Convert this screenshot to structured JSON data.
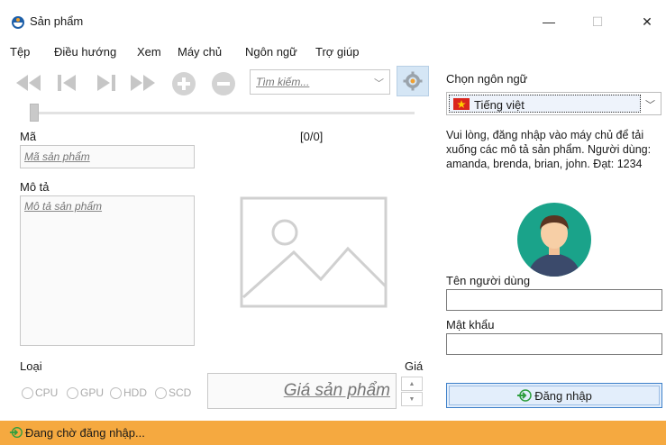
{
  "window": {
    "title": "Sản phẩm",
    "minimize_glyph": "—",
    "maximize_glyph": "☐",
    "close_glyph": "✕"
  },
  "menu": [
    "Tệp",
    "Điều hướng",
    "Xem",
    "Máy chủ",
    "Ngôn ngữ",
    "Trợ giúp"
  ],
  "toolbar": {
    "icons": [
      "rewind-icon",
      "skip-back-icon",
      "skip-forward-icon",
      "fast-forward-icon",
      "add-icon",
      "remove-icon"
    ],
    "search_placeholder": "Tìm kiếm...",
    "settings_icon": "gear-icon"
  },
  "product": {
    "code_label": "Mã",
    "code_placeholder": "Mã sản phẩm",
    "counter": "[0/0]",
    "description_label": "Mô tả",
    "description_placeholder": "Mô tả sản phẩm",
    "type_label": "Loại",
    "types": [
      "CPU",
      "GPU",
      "HDD",
      "SCD"
    ],
    "price_label": "Giá",
    "price_placeholder": "Giá sản phẩm"
  },
  "login": {
    "language_label": "Chọn ngôn ngữ",
    "language_value": "Tiếng việt",
    "info": "Vui lòng, đăng nhập vào máy chủ để tải xuống các mô tả sản phẩm. Người dùng: amanda, brenda, brian, john. Đạt: 1234",
    "username_label": "Tên người dùng",
    "password_label": "Mật khẩu",
    "button_label": "Đăng nhập"
  },
  "status": {
    "text": "Đang chờ đăng nhập..."
  },
  "colors": {
    "status_bar": "#f5a940",
    "accent": "#3c7fc9",
    "avatar_bg": "#1aa38a"
  }
}
